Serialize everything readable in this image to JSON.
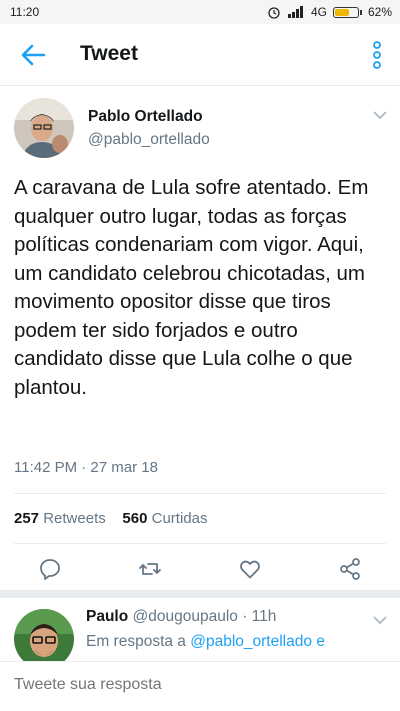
{
  "status_bar": {
    "time": "11:20",
    "network": "4G",
    "battery_text": "62%",
    "battery_level": 0.62
  },
  "app_bar": {
    "title": "Tweet"
  },
  "tweet": {
    "author_name": "Pablo Ortellado",
    "author_handle": "@pablo_ortellado",
    "text": "A caravana de Lula sofre atentado. Em qualquer outro lugar, todas as forças políticas condenariam com vigor. Aqui, um candidato celebrou chicotadas, um movimento opositor disse que tiros podem ter sido forjados e outro candidato disse que Lula colhe o que plantou.",
    "timestamp": "11:42 PM · 27 mar 18",
    "retweets_count": "257",
    "retweets_label": "Retweets",
    "likes_count": "560",
    "likes_label": "Curtidas"
  },
  "reply": {
    "author_name": "Paulo",
    "author_handle": "@dougoupaulo",
    "time": "· 11h",
    "context_prefix": "Em resposta a",
    "context_mention": "@pablo_ortellado",
    "context_suffix": "e"
  },
  "compose": {
    "placeholder": "Tweete sua resposta"
  },
  "colors": {
    "accent": "#1da1f2",
    "secondary_text": "#657786",
    "divider": "#e6ecf0"
  }
}
